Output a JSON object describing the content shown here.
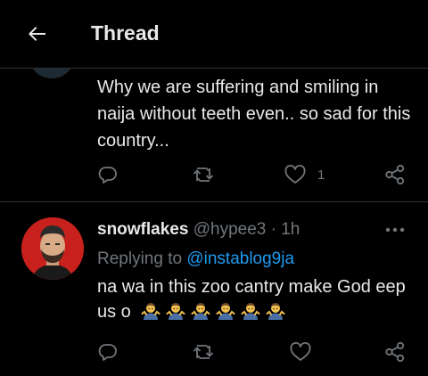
{
  "header": {
    "title": "Thread",
    "back_icon": "arrow-left-icon"
  },
  "previous_tweet": {
    "text": "Why we are suffering and smiling in naija without teeth even.. so sad for this country...",
    "actions": {
      "reply_icon": "reply-icon",
      "retweet_icon": "retweet-icon",
      "like_icon": "heart-icon",
      "like_count": "1",
      "share_icon": "share-icon"
    }
  },
  "tweet": {
    "display_name": "snowflakes",
    "handle": "@hypee3",
    "separator": "·",
    "time": "1h",
    "replying_prefix": "Replying to",
    "replying_to": "@instablog9ja",
    "text": "na wa in this zoo cantry make God eep us o",
    "emoji_name": "man-shrugging-emoji",
    "emoji_count": 6,
    "more_icon": "more-horizontal-icon",
    "actions": {
      "reply_icon": "reply-icon",
      "retweet_icon": "retweet-icon",
      "like_icon": "heart-icon",
      "share_icon": "share-icon"
    }
  },
  "colors": {
    "background": "#000000",
    "text": "#e7e9ea",
    "muted": "#71767b",
    "link": "#1d9bf0",
    "divider": "#2f3336",
    "avatar_bg": "#c8211d"
  }
}
